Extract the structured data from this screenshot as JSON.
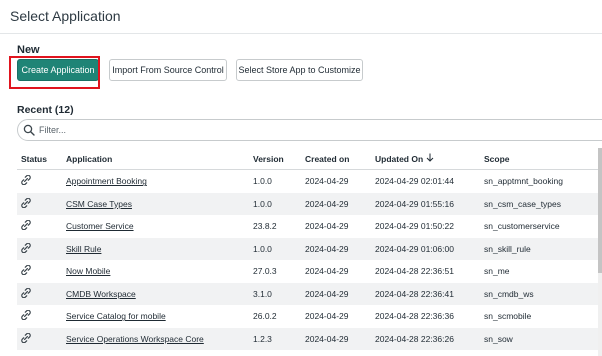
{
  "dialog": {
    "title": "Select Application"
  },
  "new_section": {
    "heading": "New",
    "create_label": "Create Application",
    "import_label": "Import From Source Control",
    "store_label": "Select Store App to Customize"
  },
  "recent_section": {
    "heading": "Recent (12)",
    "filter_placeholder": "Filter..."
  },
  "table": {
    "columns": {
      "status": "Status",
      "application": "Application",
      "version": "Version",
      "created": "Created on",
      "updated": "Updated On",
      "scope": "Scope"
    },
    "sorted_column": "updated",
    "sort_direction": "descending",
    "rows": [
      {
        "application": "Appointment Booking",
        "version": "1.0.0",
        "created": "2024-04-29",
        "updated": "2024-04-29 02:01:44",
        "scope": "sn_apptmnt_booking"
      },
      {
        "application": "CSM Case Types",
        "version": "1.0.0",
        "created": "2024-04-29",
        "updated": "2024-04-29 01:55:16",
        "scope": "sn_csm_case_types"
      },
      {
        "application": "Customer Service",
        "version": "23.8.2",
        "created": "2024-04-29",
        "updated": "2024-04-29 01:50:22",
        "scope": "sn_customerservice"
      },
      {
        "application": "Skill Rule",
        "version": "1.0.0",
        "created": "2024-04-29",
        "updated": "2024-04-29 01:06:00",
        "scope": "sn_skill_rule"
      },
      {
        "application": "Now Mobile",
        "version": "27.0.3",
        "created": "2024-04-29",
        "updated": "2024-04-28 22:36:51",
        "scope": "sn_me"
      },
      {
        "application": "CMDB Workspace",
        "version": "3.1.0",
        "created": "2024-04-29",
        "updated": "2024-04-28 22:36:41",
        "scope": "sn_cmdb_ws"
      },
      {
        "application": "Service Catalog for mobile",
        "version": "26.0.2",
        "created": "2024-04-29",
        "updated": "2024-04-28 22:36:36",
        "scope": "sn_scmobile"
      },
      {
        "application": "Service Operations Workspace Core",
        "version": "1.2.3",
        "created": "2024-04-29",
        "updated": "2024-04-28 22:36:26",
        "scope": "sn_sow"
      }
    ]
  },
  "icons": {
    "status": "link-chain-icon",
    "search": "search-icon",
    "sort": "arrow-down-icon"
  },
  "colors": {
    "primary_button": "#1f8476",
    "highlight": "#e0141e",
    "stripe": "#f1f2f3"
  }
}
